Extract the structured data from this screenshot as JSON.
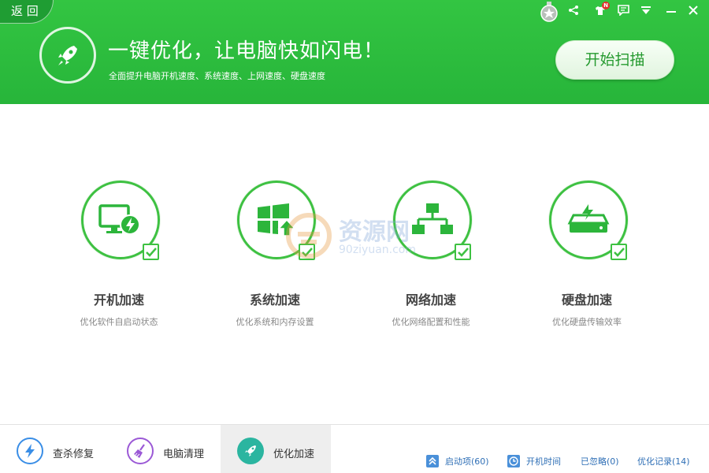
{
  "header": {
    "back_label": "返 回",
    "headline": "一键优化，让电脑快如闪电！",
    "subline": "全面提升电脑开机速度、系统速度、上网速度、硬盘速度",
    "scan_button": "开始扫描",
    "notification_badge": "N"
  },
  "features": [
    {
      "title": "开机加速",
      "desc": "优化软件自启动状态",
      "icon": "monitor-bolt-icon",
      "checked": true
    },
    {
      "title": "系统加速",
      "desc": "优化系统和内存设置",
      "icon": "windows-arrow-icon",
      "checked": true
    },
    {
      "title": "网络加速",
      "desc": "优化网络配置和性能",
      "icon": "network-icon",
      "checked": true
    },
    {
      "title": "硬盘加速",
      "desc": "优化硬盘传输效率",
      "icon": "harddisk-bolt-icon",
      "checked": true
    }
  ],
  "watermark": {
    "text": "资源网",
    "url": "90ziyuan.com"
  },
  "bottom_nav": [
    {
      "label": "查杀修复",
      "icon": "bolt-icon",
      "color": "#3a8ee6"
    },
    {
      "label": "电脑清理",
      "icon": "broom-icon",
      "color": "#9b59d6"
    },
    {
      "label": "优化加速",
      "icon": "rocket-icon",
      "color": "#2bb5a0",
      "active": true
    }
  ],
  "status_links": [
    {
      "label": "启动项(60)",
      "icon": "startup-icon"
    },
    {
      "label": "开机时间",
      "icon": "clock-icon"
    },
    {
      "label": "已忽略(0)"
    },
    {
      "label": "优化记录(14)"
    }
  ],
  "colors": {
    "brand_green": "#2ebd3f",
    "accent_blue": "#2f6fb6"
  }
}
